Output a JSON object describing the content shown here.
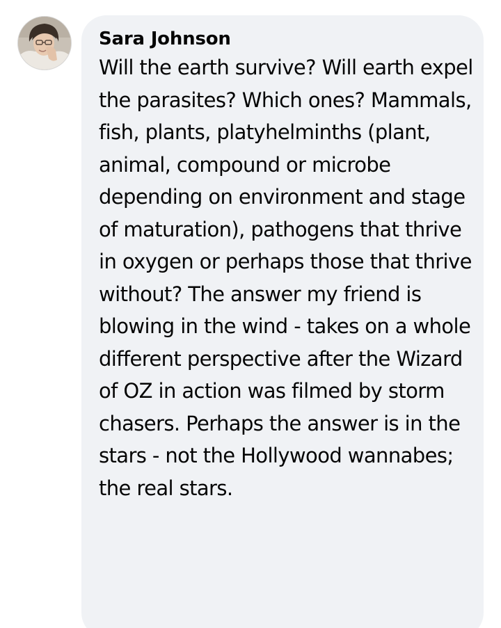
{
  "comment": {
    "author": "Sara Johnson",
    "text": "Will the earth survive? Will earth expel the parasites? Which ones? Mammals, fish, plants, platyhelminths (plant, animal, compound or microbe depending on environment and stage of maturation), pathogens that thrive in oxygen or perhaps those that thrive without? The answer my friend is blowing in the wind - takes on a whole different perspective after the Wizard of OZ in action was filmed by storm chasers. Perhaps the answer is in the stars - not the Hollywood wannabes; the real stars.",
    "avatar_icon": "profile-photo-icon"
  },
  "colors": {
    "bubble_background": "#f0f2f5",
    "text": "#050505",
    "page_background": "#ffffff"
  }
}
